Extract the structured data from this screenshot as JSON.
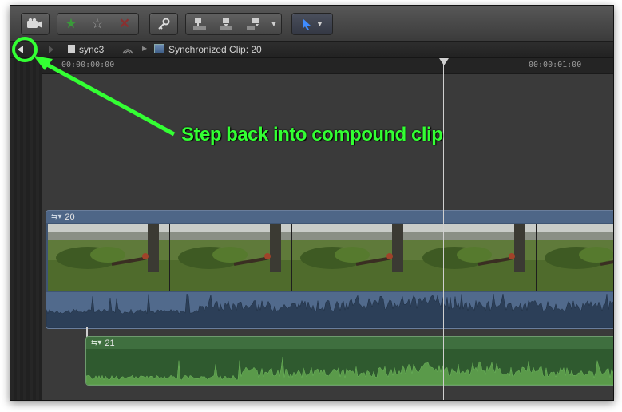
{
  "toolbar": {
    "camera_icon": "camera-import-icon",
    "favorite_icon": "star-filled",
    "unrate_icon": "star-outline",
    "reject_icon": "x-mark",
    "keyword_icon": "key",
    "edit_icons": [
      "connect-clip",
      "insert-clip",
      "append-clip"
    ],
    "tool_icon": "arrow-select"
  },
  "pathbar": {
    "project_name": "sync3",
    "clip_name": "Synchronized Clip: 20"
  },
  "ruler": {
    "start_time": "00:00:00:00",
    "next_time": "00:00:01:00"
  },
  "clips": {
    "video_clip_label": "20",
    "audio_clip_label": "21"
  },
  "annotation": {
    "text": "Step back into compound clip",
    "color": "#33ff33"
  },
  "colors": {
    "video_clip_blue": "#3f5573",
    "audio_clip_green": "#3b6a3b"
  }
}
